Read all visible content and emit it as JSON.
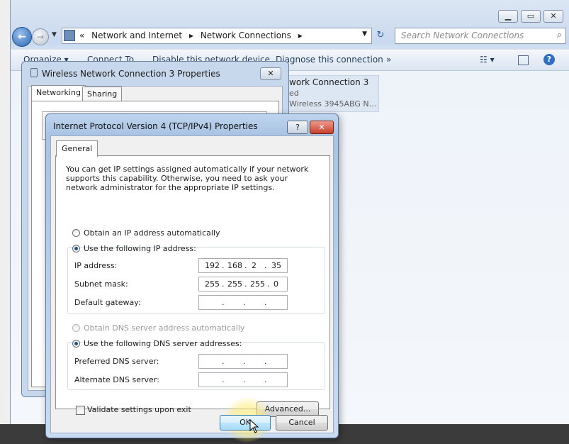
{
  "explorer": {
    "breadcrumb": [
      "Network and Internet",
      "Network Connections"
    ],
    "breadcrumb_prefix": "«",
    "search_placeholder": "Search Network Connections",
    "commands": [
      "Organize ▾",
      "Connect To",
      "Disable this network device",
      "Diagnose this connection",
      "»"
    ],
    "connection_tile": {
      "name": "work Connection 3",
      "status": "ed",
      "adapter": "Wireless 3945ABG N..."
    }
  },
  "wireless_dialog": {
    "title": "Wireless Network Connection 3 Properties",
    "tabs": [
      "Networking",
      "Sharing"
    ]
  },
  "ipv4_dialog": {
    "title": "Internet Protocol Version 4 (TCP/IPv4) Properties",
    "help_label": "?",
    "close_label": "✕",
    "tab": "General",
    "intro": "You can get IP settings assigned automatically if your network supports this capability. Otherwise, you need to ask your network administrator for the appropriate IP settings.",
    "ip_auto_label": "Obtain an IP address automatically",
    "ip_manual_label": "Use the following IP address:",
    "ip_mode": "manual",
    "ip_address_label": "IP address:",
    "ip_address": [
      "192",
      "168",
      "2",
      "35"
    ],
    "subnet_label": "Subnet mask:",
    "subnet_mask": [
      "255",
      "255",
      "255",
      "0"
    ],
    "gateway_label": "Default gateway:",
    "dns_auto_label": "Obtain DNS server address automatically",
    "dns_manual_label": "Use the following DNS server addresses:",
    "dns_mode": "manual",
    "preferred_dns_label": "Preferred DNS server:",
    "alternate_dns_label": "Alternate DNS server:",
    "validate_label": "Validate settings upon exit",
    "validate_checked": false,
    "advanced_label": "Advanced...",
    "ok_label": "OK",
    "cancel_label": "Cancel"
  },
  "colors": {
    "accent": "#2a64b3",
    "title_bar": "#bfd4ee",
    "close": "#c6402b"
  }
}
